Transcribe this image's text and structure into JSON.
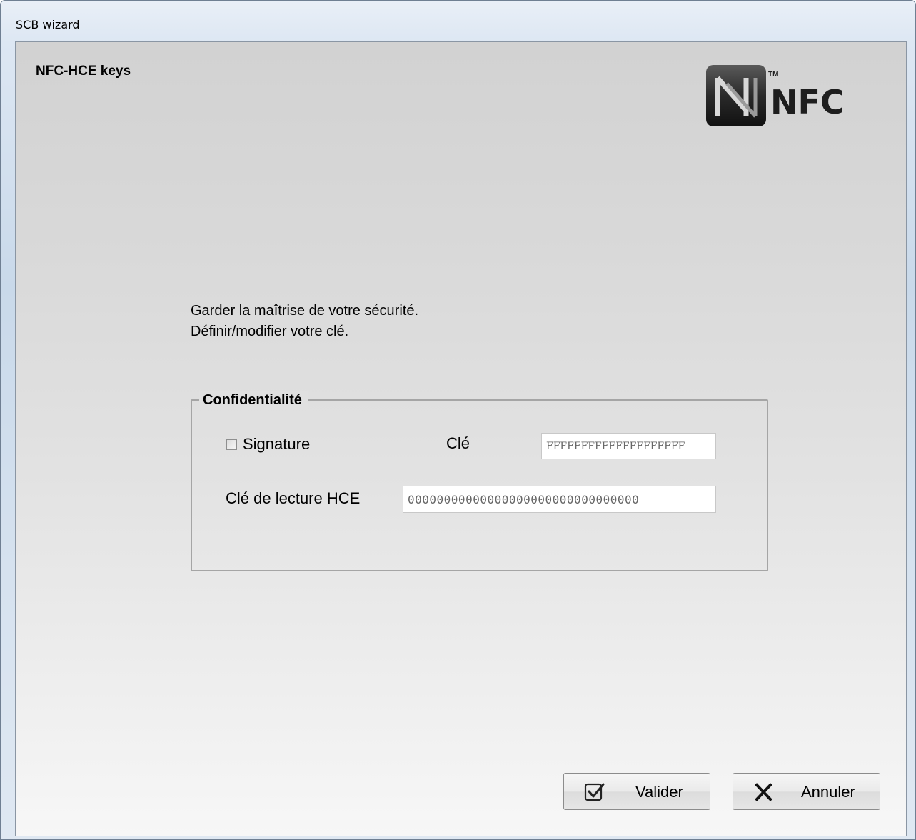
{
  "window": {
    "title": "SCB wizard"
  },
  "header": {
    "page_title": "NFC-HCE keys",
    "logo_text": "NFC",
    "logo_trademark": "TM"
  },
  "intro": {
    "line1": "Garder la maîtrise de votre sécurité.",
    "line2": "Définir/modifier votre clé."
  },
  "confidentiality": {
    "legend": "Confidentialité",
    "signature_label": "Signature",
    "signature_checked": false,
    "key_label": "Clé",
    "key_value": "FFFFFFFFFFFFFFFFFFFF",
    "hce_label": "Clé de lecture HCE",
    "hce_value": "00000000000000000000000000000000"
  },
  "buttons": {
    "ok_label": "Valider",
    "ok_icon": "checkbox-check-icon",
    "cancel_label": "Annuler",
    "cancel_icon": "close-x-icon"
  }
}
